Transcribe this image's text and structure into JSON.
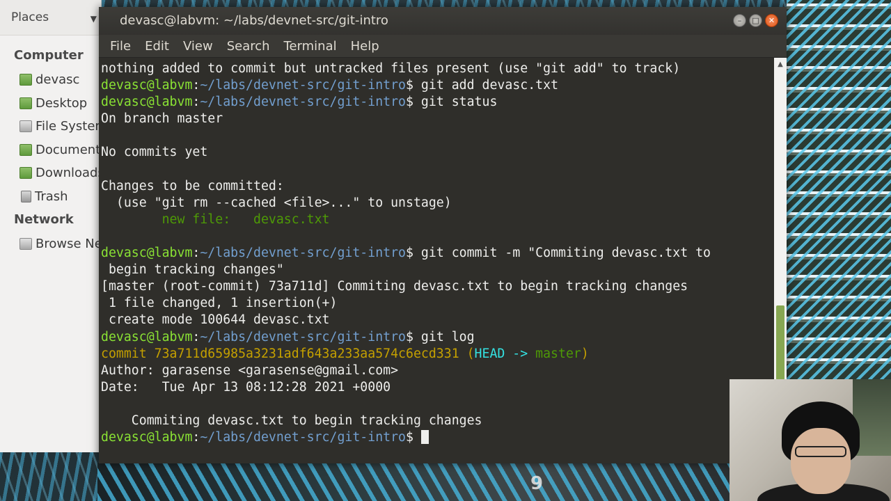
{
  "file_manager": {
    "header": "Places",
    "sections": [
      {
        "title": "Computer",
        "items": [
          "devasc",
          "Desktop",
          "File System",
          "Documents",
          "Downloads",
          "Trash"
        ]
      },
      {
        "title": "Network",
        "items": [
          "Browse Network"
        ]
      }
    ]
  },
  "background": {
    "rack_label": "9"
  },
  "terminal": {
    "title": "devasc@labvm: ~/labs/devnet-src/git-intro",
    "menu": [
      "File",
      "Edit",
      "View",
      "Search",
      "Terminal",
      "Help"
    ],
    "prompt_user": "devasc@labvm",
    "prompt_path": "~/labs/devnet-src/git-intro",
    "lines": {
      "l1": "nothing added to commit but untracked files present (use \"git add\" to track)",
      "l2_cmd": " git add devasc.txt",
      "l3_cmd": " git status",
      "l4": "On branch master",
      "l5": "",
      "l6": "No commits yet",
      "l7": "",
      "l8": "Changes to be committed:",
      "l9": "  (use \"git rm --cached <file>...\" to unstage)",
      "l10": "        new file:   devasc.txt",
      "l11": "",
      "l12_cmd": " git commit -m \"Commiting devasc.txt to",
      "l13": " begin tracking changes\"",
      "l14": "[master (root-commit) 73a711d] Commiting devasc.txt to begin tracking changes",
      "l15": " 1 file changed, 1 insertion(+)",
      "l16": " create mode 100644 devasc.txt",
      "l17_cmd": " git log",
      "l18_commit": "commit 73a711d65985a3231adf643a233aa574c6ecd331 (",
      "l18_head": "HEAD -> ",
      "l18_branch": "master",
      "l18_end": ")",
      "l19": "Author: garasense <garasense@gmail.com>",
      "l20": "Date:   Tue Apr 13 08:12:28 2021 +0000",
      "l21": "",
      "l22": "    Commiting devasc.txt to begin tracking changes",
      "l23_cmd": " "
    }
  },
  "colors": {
    "terminal_bg": "#2f2e2a",
    "prompt_user": "#8ae234",
    "prompt_path": "#729fcf",
    "new_file": "#4e9a06",
    "commit_hash": "#c4a000",
    "head_ref": "#34e2e2",
    "close_button": "#e25716"
  },
  "icons": [
    "home-folder-icon",
    "desktop-folder-icon",
    "drive-icon",
    "documents-folder-icon",
    "downloads-folder-icon",
    "trash-icon",
    "network-icon"
  ]
}
